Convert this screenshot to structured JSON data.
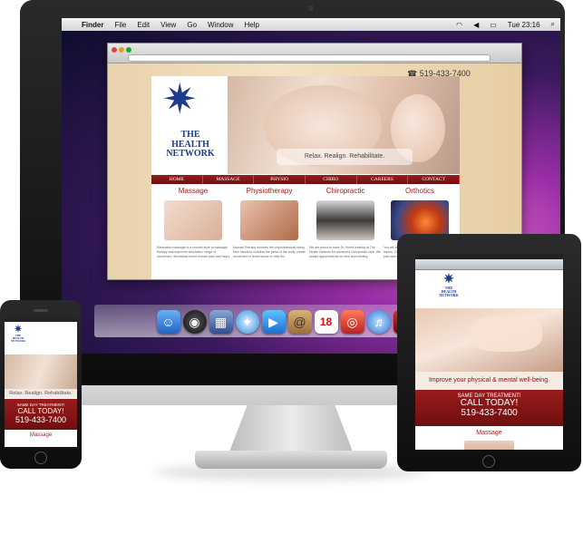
{
  "mac": {
    "apple_icon": "",
    "menus": [
      "Finder",
      "File",
      "Edit",
      "View",
      "Go",
      "Window",
      "Help"
    ],
    "clock": "Tue 23:16",
    "status_icons": [
      "wifi-icon",
      "volume-icon",
      "battery-icon",
      "search-icon"
    ],
    "dock_icons": [
      "finder-icon",
      "dashboard-icon",
      "mission-control-icon",
      "safari-icon",
      "facetime-icon",
      "contacts-icon",
      "calendar-icon",
      "photo-booth-icon",
      "itunes-icon",
      "photo-icon",
      "time-machine-icon",
      "system-preferences-icon"
    ],
    "calendar_day": "18"
  },
  "site": {
    "phone": "519-433-7400",
    "logo_line1": "THE",
    "logo_line2": "HEALTH",
    "logo_line3": "NETWORK",
    "tagline": "Relax. Realign. Rehabilitate.",
    "nav": [
      "HOME",
      "MASSAGE",
      "PHYSIO",
      "CHIRO",
      "CAREERS",
      "CONTACT"
    ],
    "columns": [
      {
        "title": "Massage",
        "text": "Relaxation massage is a smooth style of massage therapy that improves circulation, range of movement, decreases minor muscle pain and helps"
      },
      {
        "title": "Physiotherapy",
        "text": "Manual Therapy involves the physiotherapist using their hands to mobilize the joints of the body, create movement in tense tissue or help the"
      },
      {
        "title": "Chiropractic",
        "text": "We are proud to have Dr. Horek treating at The Health Network for advanced chiropractic care. We accept appointments for new and existing"
      },
      {
        "title": "Orthotics",
        "text": "You will be a few steps closer to solving your issues. Your feet are the foundation... minimize pain and discomfort by creating better posture"
      }
    ]
  },
  "ipad": {
    "tagline": "Improve your physical & mental well-being.",
    "cta_line1": "SAME DAY TREATMENT!",
    "cta_line2": "CALL TODAY!",
    "cta_phone": "519-433-7400",
    "section": "Massage"
  },
  "iphone": {
    "tagline": "Relax. Realign. Rehabilitate.",
    "cta_line1": "SAME DAY TREATMENT!",
    "cta_line2": "CALL TODAY!",
    "cta_phone": "519-433-7400",
    "section": "Massage"
  },
  "colors": {
    "brand_red": "#8b1717",
    "brand_blue": "#1e3a8a"
  }
}
